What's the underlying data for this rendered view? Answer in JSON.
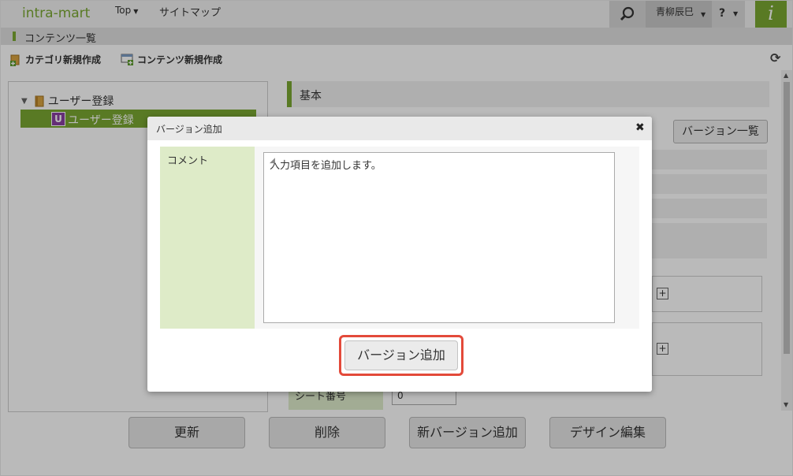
{
  "header": {
    "logo": "intra-mart",
    "nav_top": "Top",
    "nav_sitemap": "サイトマップ",
    "user": "青柳辰巳",
    "help": "?",
    "brand_logo": "i"
  },
  "page_title": "コンテンツ一覧",
  "toolbar": {
    "new_category": "カテゴリ新規作成",
    "new_content": "コンテンツ新規作成",
    "refresh_icon": "refresh-icon"
  },
  "tree": {
    "root_label": "ユーザー登録",
    "selected_badge": "U",
    "selected_label": "ユーザー登録"
  },
  "detail": {
    "section_title": "基本",
    "version_list_button": "バージョン一覧",
    "plus_symbol": "+",
    "sheet_number_label": "シート番号",
    "sheet_number_value": "0"
  },
  "actions": {
    "update": "更新",
    "delete": "削除",
    "add_new_version": "新バージョン追加",
    "design_edit": "デザイン編集"
  },
  "dialog": {
    "title": "バージョン追加",
    "close": "✖",
    "comment_label": "コメント",
    "comment_value": "入力項目を追加します。",
    "submit": "バージョン追加"
  },
  "colors": {
    "accent_green": "#7aa832",
    "label_green": "#deebc8",
    "highlight_red": "#e34a3a",
    "badge_purple": "#8a3fa2"
  }
}
